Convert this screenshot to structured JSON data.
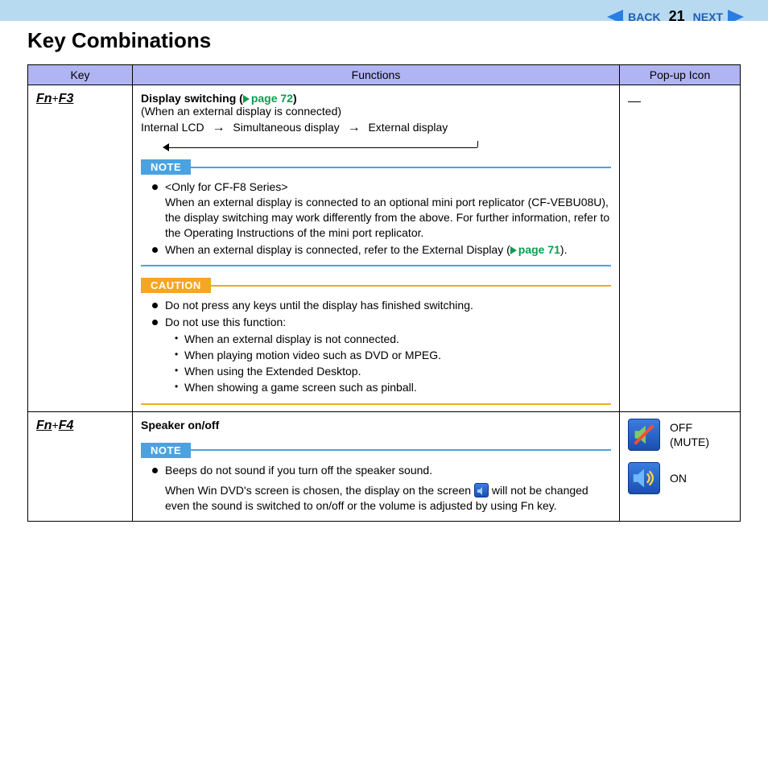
{
  "header": {
    "title": "Key Combinations",
    "back_label": "BACK",
    "next_label": "NEXT",
    "page_number": "21"
  },
  "table": {
    "columns": {
      "key": "Key",
      "functions": "Functions",
      "icon": "Pop-up Icon"
    }
  },
  "row1": {
    "key_fn": "Fn",
    "key_plus": "+",
    "key_fx": "F3",
    "title_prefix": "Display switching (",
    "title_link": "page 72",
    "title_suffix": ")",
    "subtitle": "(When an external display is connected)",
    "flow_a": "Internal LCD",
    "flow_b": "Simultaneous display",
    "flow_c": "External display",
    "note_label": "NOTE",
    "note_item1_line1": "<Only for CF-F8 Series>",
    "note_item1_line2": "When an external display is connected to an optional mini port replicator (CF-VEBU08U), the display switching may work differently from the above. For further information, refer to the Operating Instructions of the mini port replicator.",
    "note_item2_prefix": "When an external display is connected, refer to the External Display (",
    "note_item2_link": "page 71",
    "note_item2_suffix": ").",
    "caution_label": "CAUTION",
    "caution_item1": "Do not press any keys until the display has finished switching.",
    "caution_item2": "Do not use this function:",
    "caution_sub1": "When an external display is not connected.",
    "caution_sub2": "When playing motion video such as DVD or MPEG.",
    "caution_sub3": "When using the Extended Desktop.",
    "caution_sub4": "When showing a game screen such as pinball."
  },
  "row2": {
    "key_fn": "Fn",
    "key_plus": "+",
    "key_fx": "F4",
    "title": "Speaker on/off",
    "note_label": "NOTE",
    "note_item1": "Beeps do not sound if you turn off the speaker sound.",
    "note_para_a": "When Win DVD's screen is chosen, the display on the screen ",
    "note_para_b": " will not be changed even the sound is switched to on/off or the volume is adjusted by using Fn key.",
    "icon_off_label": "OFF (MUTE)",
    "icon_on_label": "ON"
  }
}
